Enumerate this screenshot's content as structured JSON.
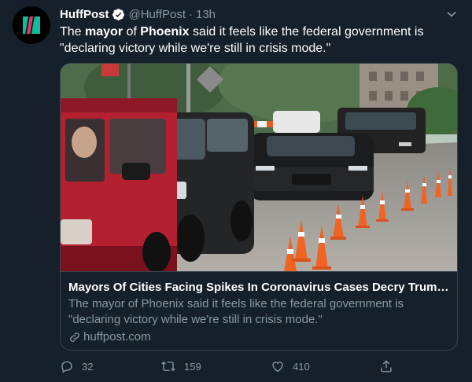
{
  "tweet": {
    "display_name": "HuffPost",
    "handle": "@HuffPost",
    "separator": "·",
    "time": "13h",
    "text_parts": [
      {
        "text": "The ",
        "bold": false
      },
      {
        "text": "mayor",
        "bold": true
      },
      {
        "text": " of ",
        "bold": false
      },
      {
        "text": "Phoenix",
        "bold": true
      },
      {
        "text": " said it feels like the federal government is \"declaring victory while we're still in crisis mode.\"",
        "bold": false
      }
    ]
  },
  "card": {
    "title": "Mayors Of Cities Facing Spikes In Coronavirus Cases Decry Trump Ad...",
    "description": "The mayor of Phoenix said it feels like the federal government is \"declaring victory while we're still in crisis mode.\"",
    "domain": "huffpost.com"
  },
  "actions": {
    "reply_count": "32",
    "retweet_count": "159",
    "like_count": "410"
  },
  "icons": {
    "verified": "verified-badge-icon",
    "caret": "chevron-down-icon",
    "reply": "reply-icon",
    "retweet": "retweet-icon",
    "like": "heart-icon",
    "share": "share-icon",
    "link": "link-icon"
  },
  "colors": {
    "background": "#15202b",
    "muted_text": "#8899a6",
    "border": "#38444d",
    "accent": "#1da1f2",
    "brand": "#00a6a6"
  }
}
